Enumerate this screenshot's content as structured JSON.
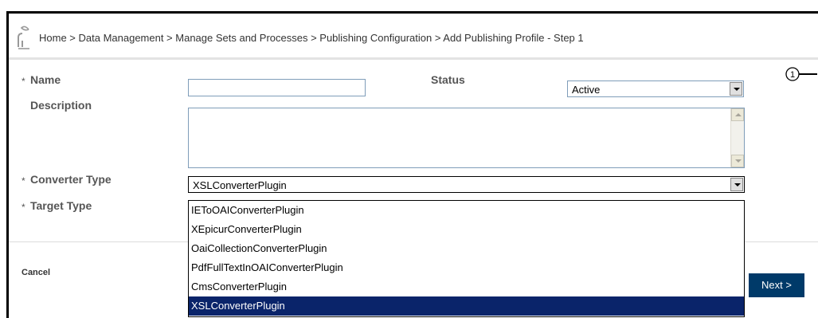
{
  "breadcrumb": "Home > Data Management > Manage Sets and Processes > Publishing Configuration > Add Publishing Profile - Step 1",
  "step_indicator": "1",
  "form": {
    "required_marker": "*",
    "name_label": "Name",
    "name_value": "",
    "status_label": "Status",
    "status_value": "Active",
    "description_label": "Description",
    "description_value": "",
    "converter_type_label": "Converter Type",
    "converter_type_value": "XSLConverterPlugin",
    "target_type_label": "Target Type"
  },
  "converter_options": [
    "IEToOAIConverterPlugin",
    "XEpicurConverterPlugin",
    "OaiCollectionConverterPlugin",
    "PdfFullTextInOAIConverterPlugin",
    "CmsConverterPlugin",
    "XSLConverterPlugin"
  ],
  "selected_option_index": 5,
  "footer": {
    "cancel_label": "Cancel",
    "next_label": "Next >"
  },
  "colors": {
    "primary_button": "#003a69",
    "selection_highlight": "#0a246a",
    "input_border": "#7f9db9"
  }
}
